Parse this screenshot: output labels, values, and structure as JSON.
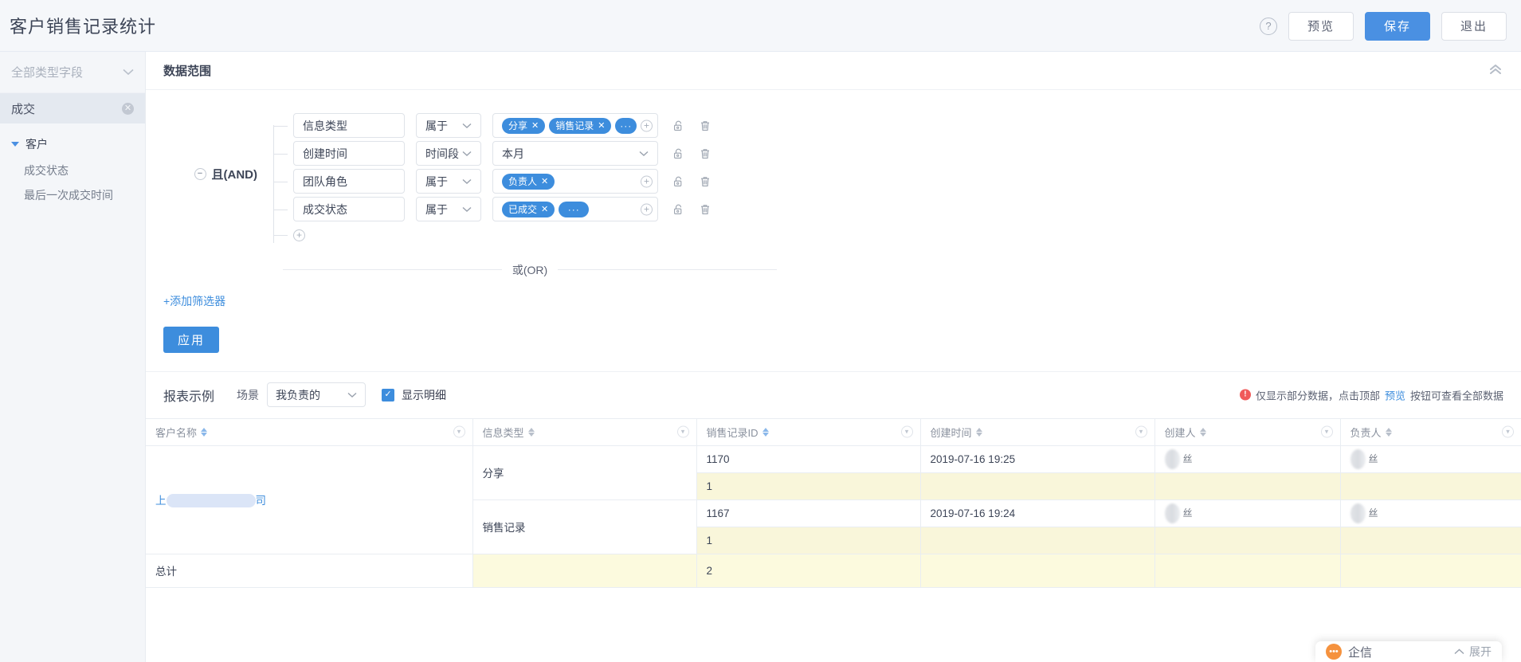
{
  "header": {
    "title": "客户销售记录统计",
    "help_icon": "question-mark-icon",
    "preview_label": "预览",
    "save_label": "保存",
    "exit_label": "退出",
    "accent": "#4a90e2"
  },
  "sidebar": {
    "field_select": "全部类型字段",
    "active_item": "成交",
    "groups": [
      {
        "label": "客户",
        "children": [
          "成交状态",
          "最后一次成交时间"
        ]
      }
    ]
  },
  "filter_panel": {
    "title": "数据范围",
    "collapse_icon": "double-chevron-up-icon",
    "group_operator": "且(AND)",
    "conditions": [
      {
        "field": "信息类型",
        "operator": "属于",
        "tags": [
          "分享",
          "销售记录"
        ],
        "more": "···"
      },
      {
        "field": "创建时间",
        "operator": "时间段",
        "value": "本月",
        "tags": [],
        "more": ""
      },
      {
        "field": "团队角色",
        "operator": "属于",
        "tags": [
          "负责人"
        ],
        "more": ""
      },
      {
        "field": "成交状态",
        "operator": "属于",
        "tags": [
          "已成交"
        ],
        "more": "···"
      }
    ],
    "or_label": "或(OR)",
    "add_filter_label": "+添加筛选器",
    "apply_label": "应用",
    "lock_icon": "unlock-icon",
    "delete_icon": "trash-icon",
    "add_icon": "plus-circle-icon"
  },
  "report_bar": {
    "title": "报表示例",
    "scene_label": "场景",
    "scene_value": "我负责的",
    "detail_label": "显示明细",
    "detail_checked": true,
    "notice_prefix": "仅显示部分数据，点击顶部",
    "notice_link": "预览",
    "notice_suffix": "按钮可查看全部数据",
    "warn_color": "#f05a5a"
  },
  "table": {
    "columns": [
      {
        "label": "客户名称",
        "sort": "active"
      },
      {
        "label": "信息类型",
        "sort": "gray"
      },
      {
        "label": "销售记录ID",
        "sort": "active"
      },
      {
        "label": "创建时间",
        "sort": "gray"
      },
      {
        "label": "创建人",
        "sort": "gray"
      },
      {
        "label": "负责人",
        "sort": "gray"
      }
    ],
    "customer_name_prefix": "上",
    "customer_name_suffix": "司",
    "groups": [
      {
        "info_type": "分享",
        "record_id": "1170",
        "created_at": "2019-07-16 19:25",
        "creator": "",
        "owner": "",
        "subtotal": "1"
      },
      {
        "info_type": "销售记录",
        "record_id": "1167",
        "created_at": "2019-07-16 19:24",
        "creator": "",
        "owner": "",
        "subtotal": "1"
      }
    ],
    "total_label": "总计",
    "total_value": "2"
  },
  "chat_widget": {
    "label": "企信",
    "expand_label": "展开",
    "icon": "chat-bubble-icon",
    "chevron": "chevron-up-icon",
    "color": "#f5923e"
  }
}
